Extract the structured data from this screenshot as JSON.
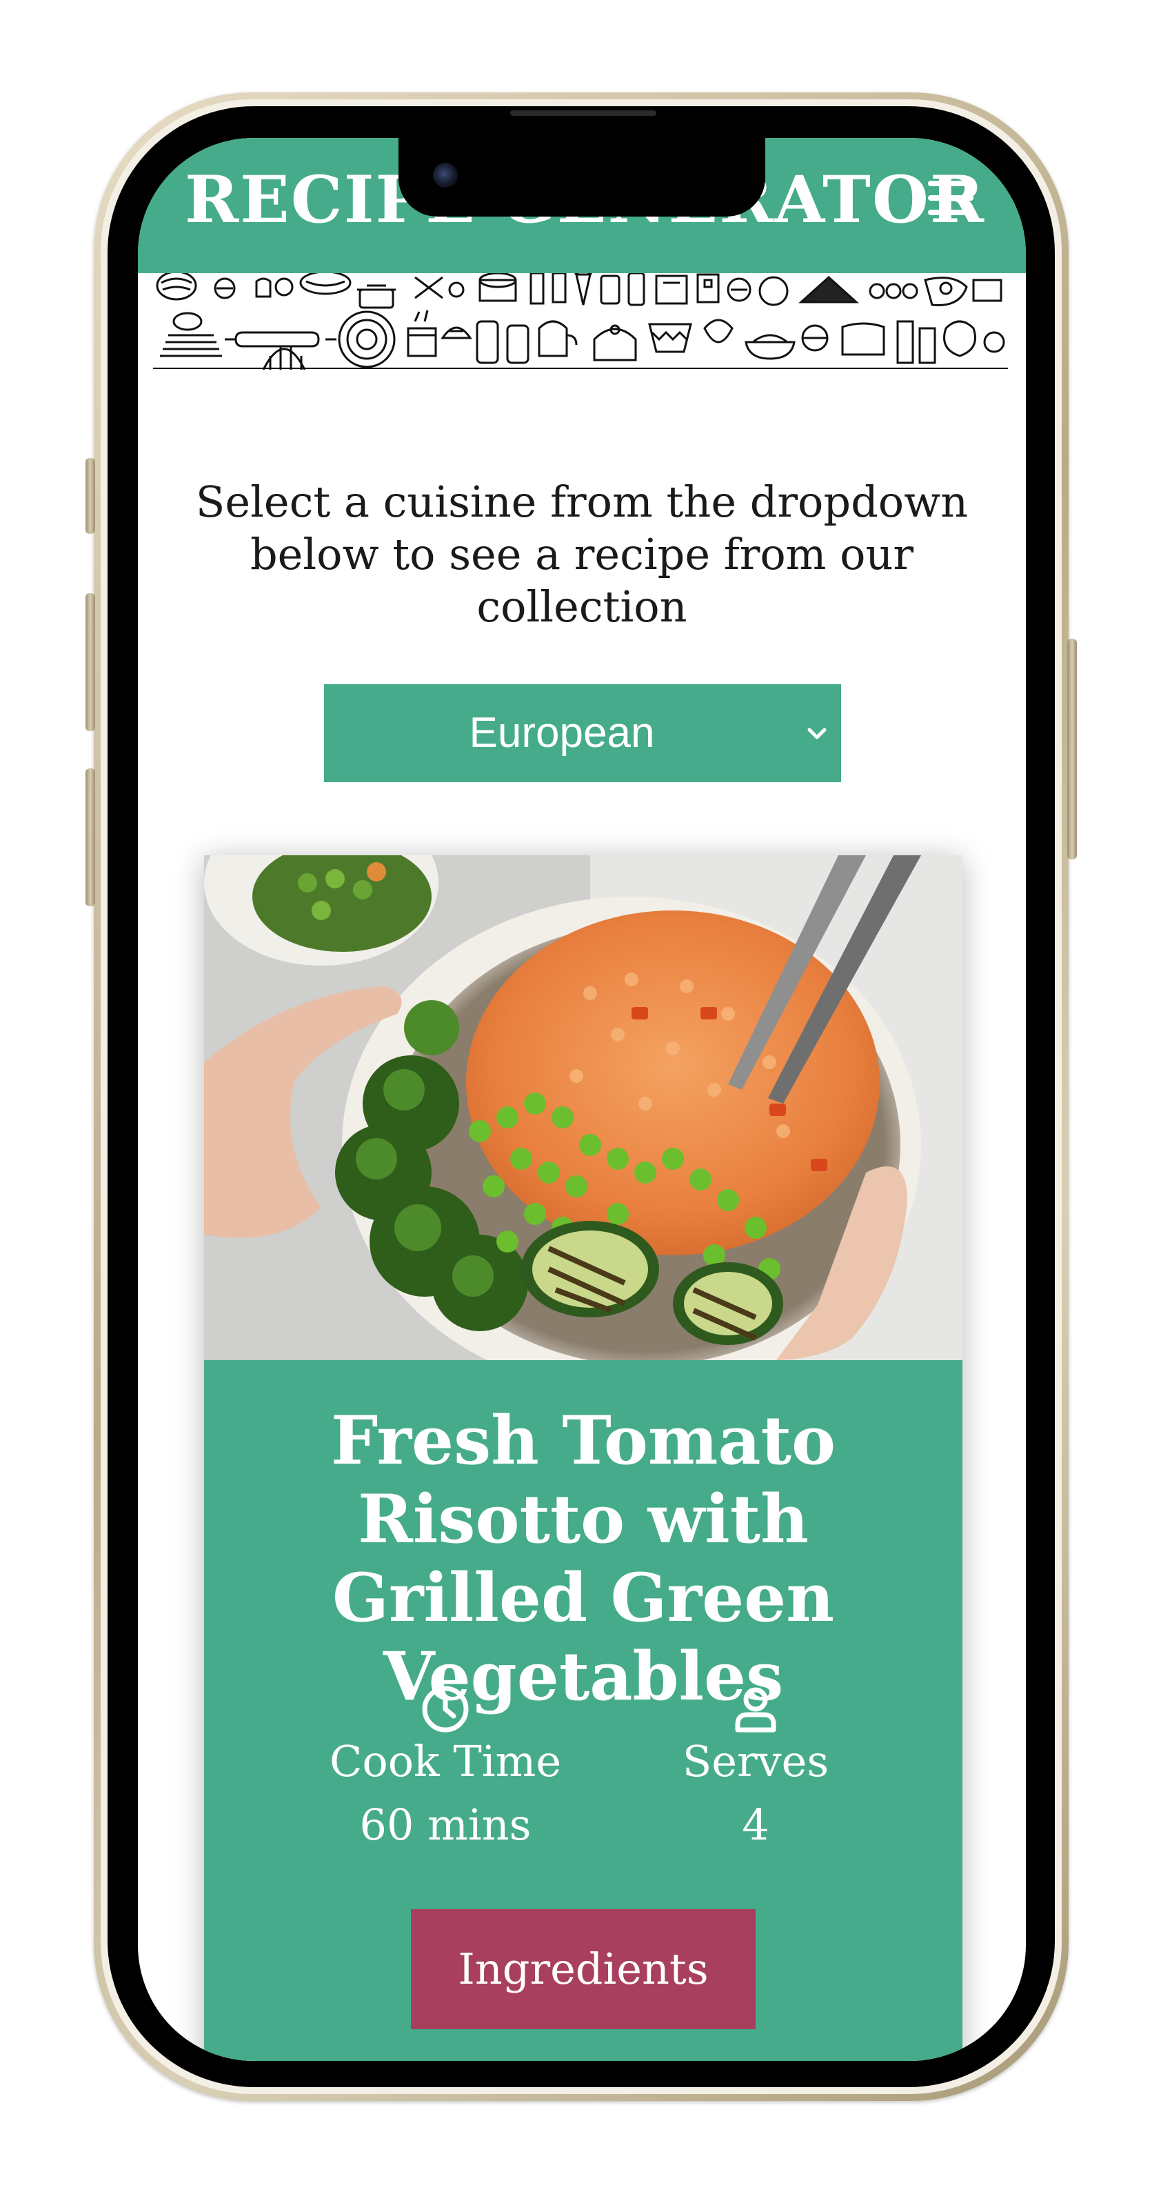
{
  "colors": {
    "primary": "#45ab8b",
    "accent": "#a83f5e",
    "text": "#1a1a1a",
    "on_primary": "#ffffff"
  },
  "header": {
    "logo": "RECIPE GENERATOR",
    "menu_icon": "hamburger-menu-icon"
  },
  "intro": {
    "text": "Select a cuisine from the dropdown below to see a recipe from our collection"
  },
  "cuisine_select": {
    "value": "European",
    "icon": "chevron-down-icon"
  },
  "recipe": {
    "title": "Fresh Tomato Risotto with Grilled Green Vegetables",
    "cook_time": {
      "icon": "clock-icon",
      "label": "Cook Time",
      "value": "60 mins"
    },
    "serves": {
      "icon": "user-icon",
      "label": "Serves",
      "value": "4"
    },
    "ingredients_button": "Ingredients"
  }
}
